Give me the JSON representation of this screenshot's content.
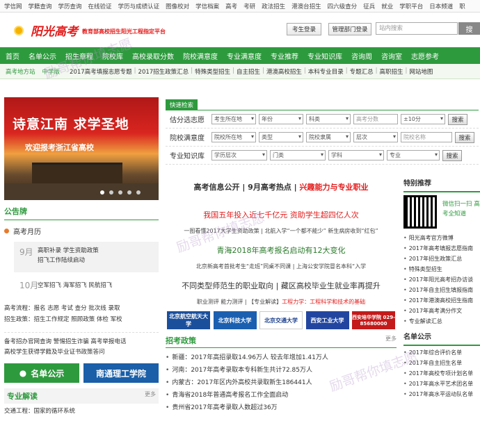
{
  "topbar": {
    "items": [
      "学信网",
      "学籍查询",
      "学历查询",
      "在线验证",
      "学历与成绩认证",
      "图像校对",
      "学信档案",
      "高考",
      "考研",
      "政法招生",
      "港澳台招生",
      "四六级查分",
      "征兵",
      "就业",
      "学职平台",
      "日本频道",
      "职"
    ]
  },
  "header": {
    "brand": "阳光高考",
    "subtitle": "教育部高校招生阳光工程指定平台",
    "login_label": "考生登录",
    "admin_label": "管理部门登录",
    "search_placeholder": "站内搜索",
    "search_button": "搜"
  },
  "nav": {
    "items": [
      "首页",
      "名单公示",
      "招生章程",
      "院校库",
      "高校录取分数",
      "院校满意度",
      "专业满意度",
      "专业推荐",
      "专业知识库",
      "咨询周",
      "咨询室",
      "志愿参考"
    ]
  },
  "subnav": {
    "region": "高考地方站",
    "level": "中学版",
    "items": [
      "2017高考填报志愿专题",
      "2017招生政策汇总",
      "特殊类型招生",
      "自主招生",
      "港澳高校招生",
      "本科专业目录",
      "专题汇总",
      "高职招生",
      "网站地图"
    ]
  },
  "banner": {
    "title": "诗意江南 求学圣地",
    "subtitle": "欢迎报考浙江省高校"
  },
  "left": {
    "announce_title": "公告牌",
    "calendar_title": "高考月历",
    "sep_month": "9月",
    "sep_lines": [
      "高职补录 学生资助政策",
      "招飞工作陆续启动"
    ],
    "oct_month": "10月",
    "oct_line": "空军招飞 海军招飞 民航招飞",
    "flow_line1": "高考流程：报名 志愿 考试 查分 批次线 录取",
    "flow_line2": "招生政策：招生工作规定 照顾政策 体检 军校",
    "links_line1": "备考招办官网查询 警惕招生诈骗 高考举报电话",
    "links_line2": "高校学生获得学籍及毕业证书政策答问",
    "btn_list": "名单公示",
    "btn_school": "南通理工学院",
    "zyjd_title": "专业解读",
    "zyjd_more": "更多",
    "zyjd_item": "交通工程：国家的循环系统"
  },
  "quick_search": {
    "tab": "快速检索",
    "row1": {
      "label": "估分选志愿",
      "fields": [
        "考生所在地",
        "年份",
        "科类",
        "高考分数",
        "±10分"
      ],
      "button": "搜索"
    },
    "row2": {
      "label": "院校满意度",
      "fields": [
        "院校所在地",
        "类型",
        "院校隶属",
        "层次",
        "院校名称"
      ],
      "button": "搜索"
    },
    "row3": {
      "label": "专业知识库",
      "fields": [
        "学历层次",
        "门类",
        "学科",
        "专业"
      ],
      "button": "搜索"
    }
  },
  "center": {
    "headline_a": "高考信息公开 | 9月高考热点 | ",
    "headline_b": "兴趣能力与专业职业",
    "h1": "我国五年投入近七千亿元 资助学生超四亿人次",
    "s1": "一图看懂2017大学生资助政策 | 北航入学“一个都不能少” 新生病房收到“红包”",
    "h2": "青海2018年高考报名启动有12大变化",
    "s2": "北京新高考首批考生“走班”同桌不同课 | 上海公安学院冒名本科“入学",
    "h3": "不同类型师范生的职业取向 | 藏区高校毕业生就业率再提升",
    "s3a": "职业测评 能力测评 | 【专业解读】",
    "s3b": "工程力学：工程科学和技术的基础",
    "logos": [
      "北京航空航天大学",
      "北京科技大学",
      "北京交通大学",
      "西安工业大学",
      "西安培华学院 029-85680000"
    ],
    "policy_title": "招考政策",
    "policy_more": "更多",
    "policy": [
      "新疆：2017年高招录取14.96万人 较去年增加1.41万人",
      "河南：2017年高考录取本专科新生共计72.85万人",
      "内蒙古：2017年区内外高校共录取新生186441人",
      "青海省2018年普通高考报名工作全面启动",
      "贵州省2017年高考录取人数超过36万"
    ]
  },
  "right": {
    "title": "特别推荐",
    "wechat": "微信扫一扫 高考全知道",
    "list": [
      "阳光高考官方微博",
      "2017年高考填报志愿指南",
      "2017年招生政策汇总",
      "特殊类型招生",
      "2017年阳光高考招办访谈",
      "2017年自主招生填报指南",
      "2017年港澳高校招生指南",
      "2017年高考满分作文",
      "专业解读汇总"
    ],
    "list2_title": "名单公示",
    "list2": [
      "2017年综合评价名单",
      "2017年自主招生名单",
      "2017年高校专项计划名单",
      "2017年高水平艺术团名单",
      "2017年高水平运动队名单"
    ]
  },
  "watermark": "励哥帮你填志愿"
}
